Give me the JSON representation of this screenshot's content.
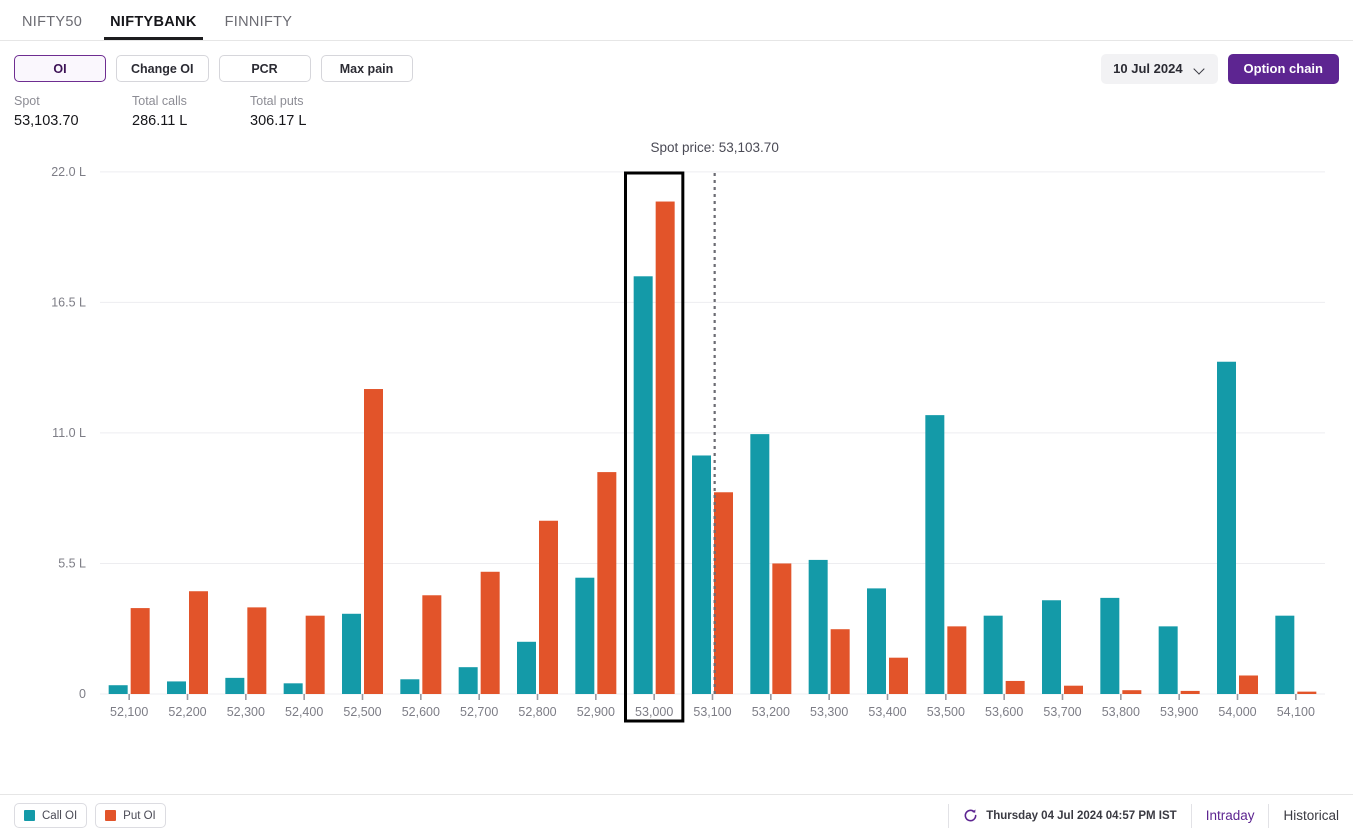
{
  "tabs": [
    {
      "label": "NIFTY50",
      "active": false
    },
    {
      "label": "NIFTYBANK",
      "active": true
    },
    {
      "label": "FINNIFTY",
      "active": false
    }
  ],
  "toolbar": {
    "modes": [
      {
        "label": "OI",
        "selected": true
      },
      {
        "label": "Change OI",
        "selected": false
      },
      {
        "label": "PCR",
        "selected": false
      },
      {
        "label": "Max pain",
        "selected": false
      }
    ],
    "expiry_label": "10 Jul 2024",
    "option_chain_label": "Option chain",
    "chevron_icon": "chevron-down-icon"
  },
  "stats": [
    {
      "label": "Spot",
      "value": "53,103.70"
    },
    {
      "label": "Total calls",
      "value": "286.11 L"
    },
    {
      "label": "Total puts",
      "value": "306.17 L"
    }
  ],
  "annotation": {
    "spot_price_text": "Spot price: 53,103.70",
    "highlighted_strike": "53,000"
  },
  "footer": {
    "legend": [
      {
        "label": "Call OI",
        "color": "#149aa8"
      },
      {
        "label": "Put OI",
        "color": "#e2542a"
      }
    ],
    "refresh_icon": "refresh-icon",
    "timestamp": "Thursday 04 Jul 2024 04:57 PM IST",
    "links": [
      {
        "label": "Intraday",
        "accent": true
      },
      {
        "label": "Historical",
        "accent": false
      }
    ]
  },
  "chart_data": {
    "type": "bar",
    "title": "",
    "xlabel": "",
    "ylabel": "",
    "ylim": [
      0,
      22.5
    ],
    "ytick_values": [
      0,
      5.5,
      11.0,
      16.5,
      22.0
    ],
    "ytick_labels": [
      "0",
      "5.5 L",
      "11.0 L",
      "16.5 L",
      "22.0 L"
    ],
    "grid": true,
    "legend_position": "bottom-left",
    "colors": {
      "call": "#149aa8",
      "put": "#e2542a",
      "highlight": "#000000",
      "spotline": "#6b6b72"
    },
    "categories": [
      "52,100",
      "52,200",
      "52,300",
      "52,400",
      "52,500",
      "52,600",
      "52,700",
      "52,800",
      "52,900",
      "53,000",
      "53,100",
      "53,200",
      "53,300",
      "53,400",
      "53,500",
      "53,600",
      "53,700",
      "53,800",
      "53,900",
      "54,000",
      "54,100"
    ],
    "series": [
      {
        "name": "Call OI",
        "values": [
          0.37,
          0.53,
          0.68,
          0.45,
          3.38,
          0.62,
          1.13,
          2.2,
          4.9,
          17.6,
          10.05,
          10.95,
          5.65,
          4.45,
          11.75,
          3.3,
          3.95,
          4.05,
          2.85,
          14.0,
          3.3
        ]
      },
      {
        "name": "Put OI",
        "values": [
          3.62,
          4.33,
          3.65,
          3.3,
          12.85,
          4.16,
          5.15,
          7.3,
          9.35,
          20.75,
          8.5,
          5.5,
          2.73,
          1.53,
          2.85,
          0.55,
          0.35,
          0.16,
          0.13,
          0.78,
          0.1
        ]
      }
    ],
    "spot_line_value": 53103.7,
    "highlight_category": "53,000"
  }
}
